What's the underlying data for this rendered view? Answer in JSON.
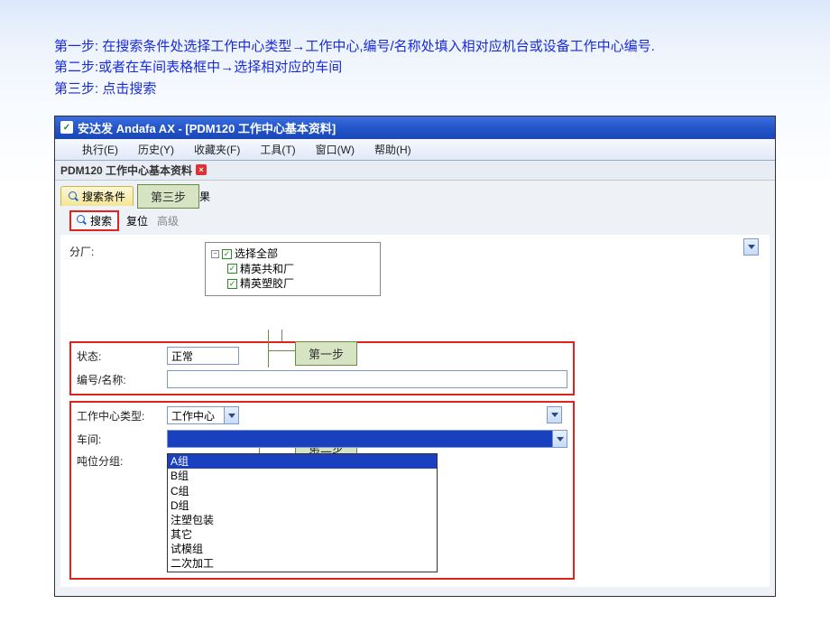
{
  "instructions": {
    "line1_label": "第一步:",
    "line1_text_a": " 在搜索条件处选择工作中心类型",
    "line1_text_b": "工作中心,编号/名称处填入相对应机台或设备工作中心编号.",
    "line2_label": "第二步:",
    "line2_text_a": "或者在车间表格框中",
    "line2_text_b": "选择相对应的车间",
    "line3_label": "第三步:",
    "line3_text": " 点击搜索",
    "arrow": "→"
  },
  "titlebar": {
    "app": "安达发 Andafa AX - [PDM120 工作中心基本资料]"
  },
  "menubar": {
    "items": [
      "执行(E)",
      "历史(Y)",
      "收藏夹(F)",
      "工具(T)",
      "窗口(W)",
      "帮助(H)"
    ]
  },
  "doctab": {
    "title": "PDM120 工作中心基本资料"
  },
  "tabs": {
    "search_cond": "搜索条件",
    "result_suffix": "果"
  },
  "toolbar": {
    "search": "搜索",
    "reset": "复位",
    "advanced": "高级"
  },
  "form": {
    "factory_label": "分厂:",
    "tree": {
      "root": "选择全部",
      "children": [
        "精英共和厂",
        "精英塑胶厂"
      ]
    },
    "status_label": "状态:",
    "status_value": "正常",
    "code_name_label": "编号/名称:",
    "wc_type_label": "工作中心类型:",
    "wc_type_value": "工作中心",
    "workshop_label": "车间:",
    "ton_group_label": "吨位分组:",
    "ton_options": [
      "A组",
      "B组",
      "C组",
      "D组",
      "注塑包装",
      "其它",
      "试模组",
      "二次加工"
    ]
  },
  "callouts": {
    "step1": "第一步",
    "step2": "第二步",
    "step3": "第三步"
  }
}
